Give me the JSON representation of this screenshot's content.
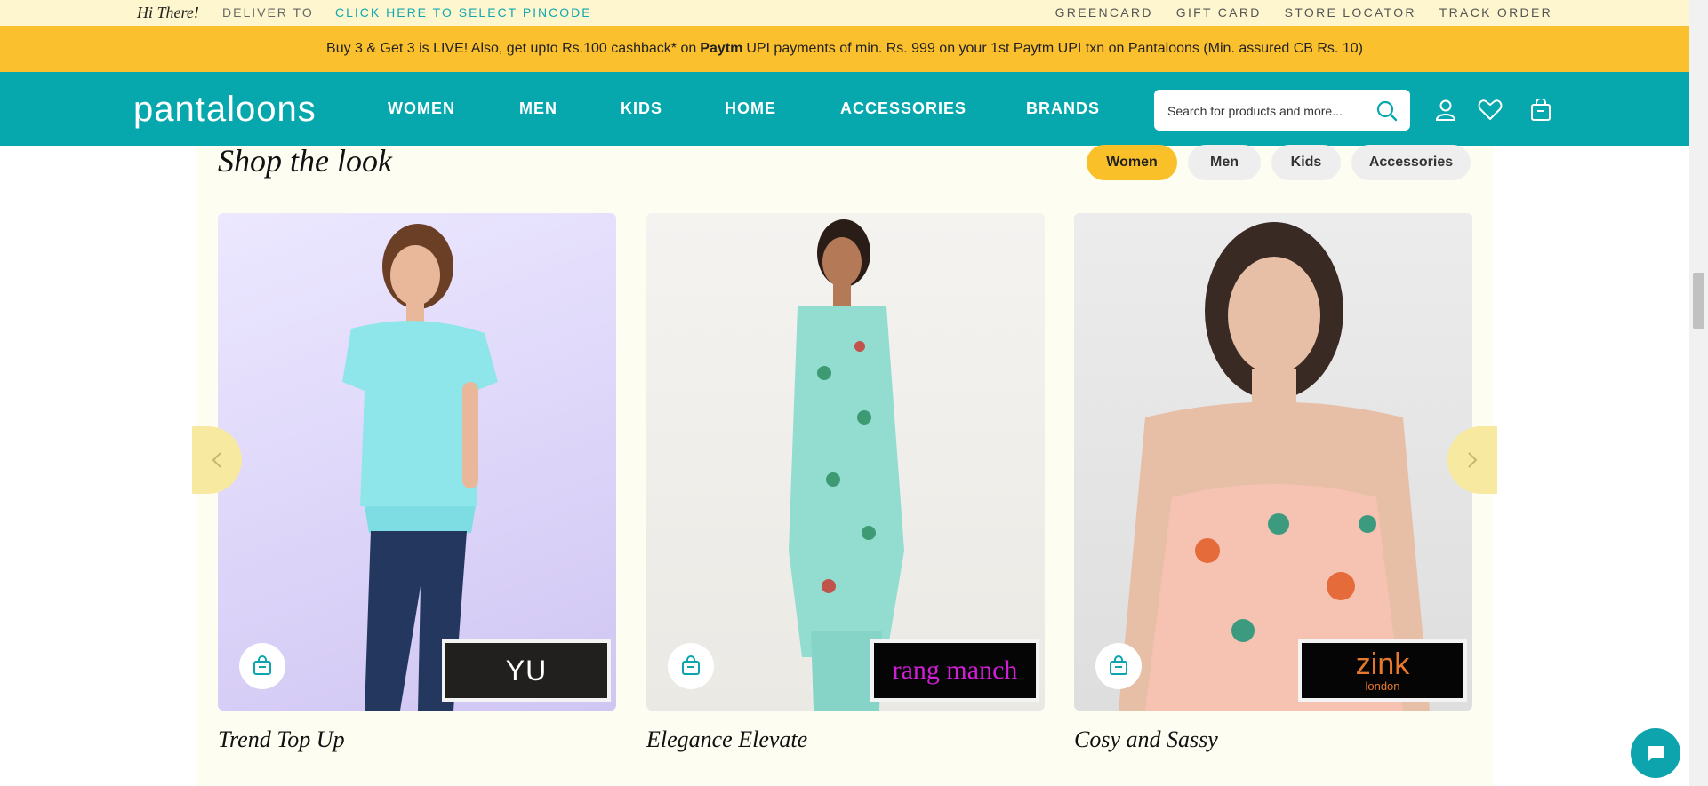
{
  "topbar": {
    "greeting": "Hi There!",
    "deliver_label": "DELIVER TO",
    "pincode_link": "CLICK HERE TO SELECT PINCODE",
    "links": [
      "GREENCARD",
      "GIFT CARD",
      "STORE LOCATOR",
      "TRACK ORDER"
    ]
  },
  "offer": {
    "text_before": "Buy 3 & Get 3 is LIVE! Also, get upto Rs.100 cashback* on",
    "brand": "Paytm",
    "text_after": "UPI payments of min. Rs. 999 on your 1st Paytm UPI txn on Pantaloons (Min. assured CB Rs. 10)"
  },
  "nav": {
    "logo": "pantaloons",
    "menu": [
      "WOMEN",
      "MEN",
      "KIDS",
      "HOME",
      "ACCESSORIES",
      "BRANDS"
    ],
    "search_placeholder": "Search for products and more..."
  },
  "shop": {
    "title": "Shop the look",
    "filters": [
      "Women",
      "Men",
      "Kids",
      "Accessories"
    ],
    "active_filter": "Women",
    "cards": [
      {
        "title": "Trend Top Up",
        "brand": "YU"
      },
      {
        "title": "Elegance Elevate",
        "brand": "rang manch"
      },
      {
        "title": "Cosy and Sassy",
        "brand_main": "zink",
        "brand_sub": "london"
      }
    ]
  },
  "colors": {
    "teal": "#07a8ad",
    "yellow": "#fbc02d",
    "cream": "#fdf6cf"
  }
}
